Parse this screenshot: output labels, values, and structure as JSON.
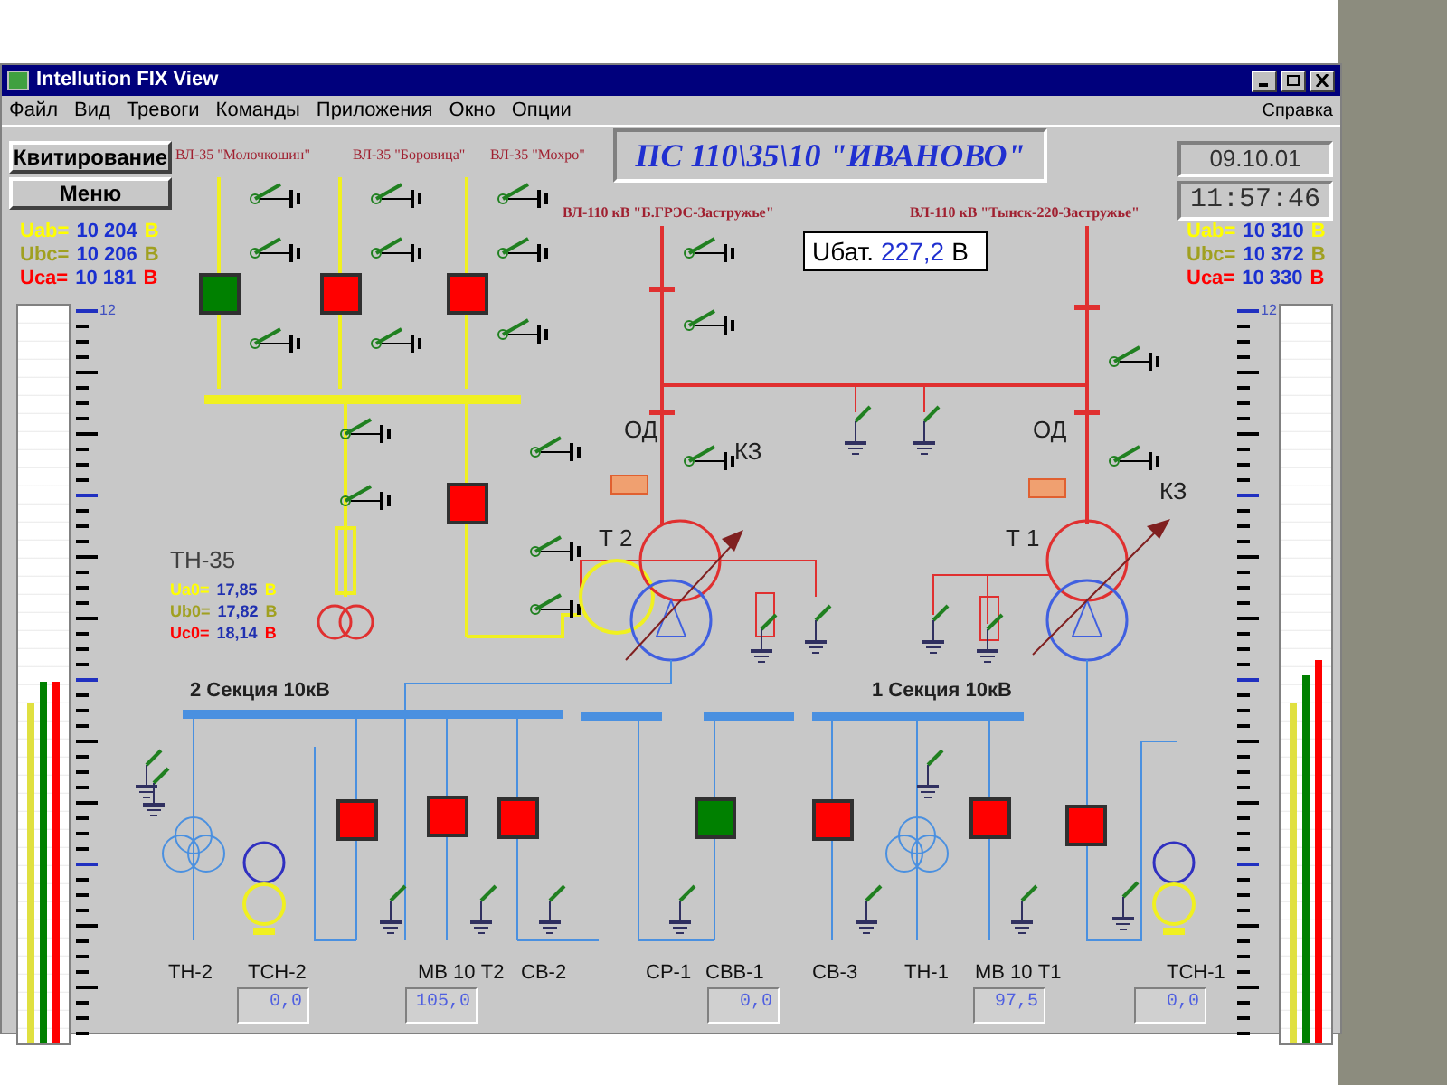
{
  "window": {
    "title": "Intellution FIX View"
  },
  "menu": [
    "Файл",
    "Вид",
    "Тревоги",
    "Команды",
    "Приложения",
    "Окно",
    "Опции"
  ],
  "help_menu": "Справка",
  "buttons": [
    "Квитирование",
    "Меню"
  ],
  "banner": "ПС 110\\35\\10  \"ИВАНОВО\"",
  "date": "09.10.01",
  "time": "11:57:46",
  "battery": {
    "label": "Uбат.",
    "value": "227,2",
    "unit": "В"
  },
  "left_voltages": [
    {
      "label": "Uab=",
      "value": "10 204",
      "unit": "В",
      "color": "#ffff00"
    },
    {
      "label": "Ubc=",
      "value": "10 206",
      "unit": "В",
      "color": "#a0a020"
    },
    {
      "label": "Uca=",
      "value": "10 181",
      "unit": "В",
      "color": "#ff0000"
    }
  ],
  "right_voltages": [
    {
      "label": "Uab=",
      "value": "10 310",
      "unit": "В",
      "color": "#ffff00"
    },
    {
      "label": "Ubc=",
      "value": "10 372",
      "unit": "В",
      "color": "#a0a020"
    },
    {
      "label": "Uca=",
      "value": "10 330",
      "unit": "В",
      "color": "#ff0000"
    }
  ],
  "left_gauge": {
    "scale": "12",
    "bars": [
      {
        "level": 0.46,
        "color": "#e0e040"
      },
      {
        "level": 0.49,
        "color": "#008000"
      },
      {
        "level": 0.49,
        "color": "#ff0000"
      }
    ]
  },
  "right_gauge": {
    "scale": "12",
    "bars": [
      {
        "level": 0.46,
        "color": "#e0e040"
      },
      {
        "level": 0.5,
        "color": "#008000"
      },
      {
        "level": 0.52,
        "color": "#ff0000"
      }
    ]
  },
  "tn35": {
    "title": "ТН-35",
    "readings": [
      {
        "label": "Ua0=",
        "value": "17,85",
        "unit": "В",
        "color": "#ffff00"
      },
      {
        "label": "Ub0=",
        "value": "17,82",
        "unit": "В",
        "color": "#a0a020"
      },
      {
        "label": "Uc0=",
        "value": "18,14",
        "unit": "В",
        "color": "#ff0000"
      }
    ]
  },
  "lines_35kv": [
    "ВЛ-35 \"Молочкошин\"",
    "ВЛ-35 \"Боровица\"",
    "ВЛ-35 \"Мохро\""
  ],
  "lines_110kv": [
    "ВЛ-110 кВ \"Б.ГРЭС-Застружье\"",
    "ВЛ-110 кВ \"Тынск-220-Застружье\""
  ],
  "equipment_labels": [
    "ОД",
    "КЗ",
    "Т 2",
    "ОД",
    "КЗ",
    "Т 1"
  ],
  "sections": [
    "2 Секция 10кВ",
    "1 Секция 10кВ"
  ],
  "bays": [
    "ТН-2",
    "ТСН-2",
    "МВ 10 Т2",
    "СВ-2",
    "СР-1",
    "СВВ-1",
    "СВ-3",
    "ТН-1",
    "МВ 10 Т1",
    "ТСН-1"
  ],
  "meters": [
    "0,0",
    "105,0",
    "0,0",
    "97,5",
    "0,0"
  ],
  "breakers": [
    {
      "color": "#008000"
    },
    {
      "color": "#ff0000"
    },
    {
      "color": "#ff0000"
    },
    {
      "color": "#ff0000"
    },
    {
      "color": "#ff0000"
    },
    {
      "color": "#ff0000"
    },
    {
      "color": "#ff0000"
    },
    {
      "color": "#008000"
    },
    {
      "color": "#ff0000"
    },
    {
      "color": "#ff0000"
    },
    {
      "color": "#ff0000"
    }
  ]
}
